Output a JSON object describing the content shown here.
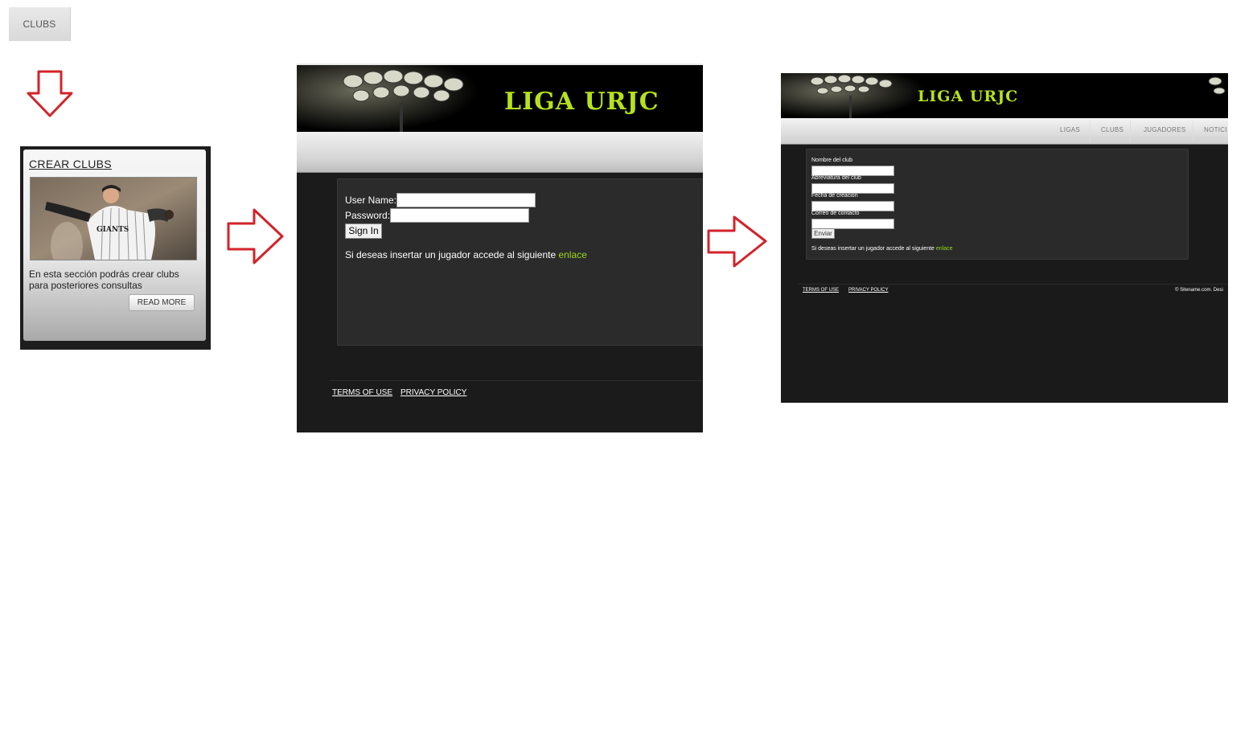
{
  "top_tab": {
    "label": "CLUBS"
  },
  "card": {
    "title": "CREAR CLUBS",
    "description": "En esta sección podrás crear clubs para posteriores consultas",
    "read_more_label": "READ MORE",
    "photo_jersey_text": "GIANTS"
  },
  "login_screen": {
    "banner_title": "LIGA URJC",
    "username_label": "User Name:",
    "password_label": "Password:",
    "sign_in_label": "Sign In",
    "hint_text": "Si deseas insertar un jugador accede al siguiente ",
    "hint_link": "enlace",
    "footer_terms": "TERMS OF USE",
    "footer_privacy": "PRIVACY POLICY"
  },
  "create_screen": {
    "banner_title": "LIGA URJC",
    "nav": [
      "LIGAS",
      "CLUBS",
      "JUGADORES",
      "NOTICI"
    ],
    "fields": [
      {
        "label": "Nombre del club"
      },
      {
        "label": "Abreviatura del club"
      },
      {
        "label": "Fecha de creacion"
      },
      {
        "label": "Correo de contacto"
      }
    ],
    "send_label": "Enviar",
    "hint_text": "Si deseas insertar un jugador accede al siguiente ",
    "hint_link": "enlace",
    "footer_terms": "TERMS OF USE",
    "footer_privacy": "PRIVACY POLICY",
    "footer_copyright": "© Sitename.com. Desi"
  },
  "colors": {
    "accent_green": "#b6e21b",
    "link_green": "#9dd81b",
    "arrow_red": "#d2232a",
    "dark_bg": "#1b1b1b"
  }
}
